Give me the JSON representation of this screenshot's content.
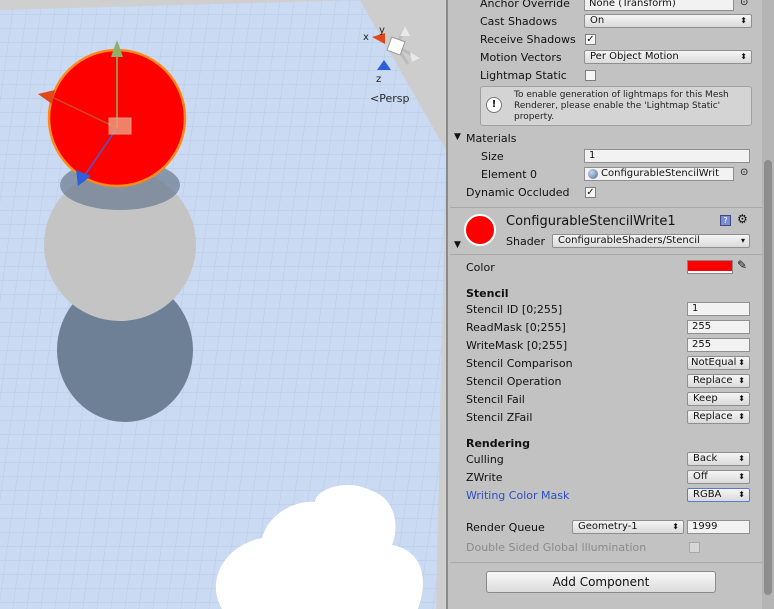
{
  "scene": {
    "persp_label": "Persp",
    "gizmo_axes": {
      "y": "y",
      "z": "z",
      "x": "x"
    }
  },
  "inspector": {
    "anchor_override": {
      "label": "Anchor Override",
      "value": "None (Transform)"
    },
    "cast_shadows": {
      "label": "Cast Shadows",
      "value": "On"
    },
    "receive_shadows": {
      "label": "Receive Shadows",
      "checked": true
    },
    "motion_vectors": {
      "label": "Motion Vectors",
      "value": "Per Object Motion"
    },
    "lightmap_static": {
      "label": "Lightmap Static",
      "checked": false
    },
    "help_box": "To enable generation of lightmaps for this Mesh Renderer, please enable the 'Lightmap Static' property.",
    "materials": {
      "label": "Materials",
      "size_label": "Size",
      "size_value": "1",
      "element0_label": "Element 0",
      "element0_value": "ConfigurableStencilWrit"
    },
    "dynamic_occluded": {
      "label": "Dynamic Occluded",
      "checked": true
    },
    "material": {
      "name": "ConfigurableStencilWrite1",
      "shader_label": "Shader",
      "shader_value": "ConfigurableShaders/Stencil",
      "swatch_color": "#ff0000"
    },
    "color": {
      "label": "Color",
      "value_color": "#ff0000"
    },
    "stencil": {
      "header": "Stencil",
      "id_label": "Stencil ID [0;255]",
      "id_value": "1",
      "readmask_label": "ReadMask [0;255]",
      "readmask_value": "255",
      "writemask_label": "WriteMask [0;255]",
      "writemask_value": "255",
      "comparison_label": "Stencil Comparison",
      "comparison_value": "NotEqual",
      "operation_label": "Stencil Operation",
      "operation_value": "Replace",
      "fail_label": "Stencil Fail",
      "fail_value": "Keep",
      "zfail_label": "Stencil ZFail",
      "zfail_value": "Replace"
    },
    "rendering": {
      "header": "Rendering",
      "culling_label": "Culling",
      "culling_value": "Back",
      "zwrite_label": "ZWrite",
      "zwrite_value": "Off",
      "colormask_label": "Writing Color Mask",
      "colormask_value": "RGBA"
    },
    "render_queue": {
      "label": "Render Queue",
      "preset": "Geometry-1",
      "value": "1999"
    },
    "double_sided_gi": {
      "label": "Double Sided Global Illumination",
      "checked": false
    },
    "add_component": "Add Component"
  },
  "colors": {
    "selection_red": "#ff0000",
    "link_blue": "#2b4fc7",
    "sky": "#c9daf2"
  }
}
